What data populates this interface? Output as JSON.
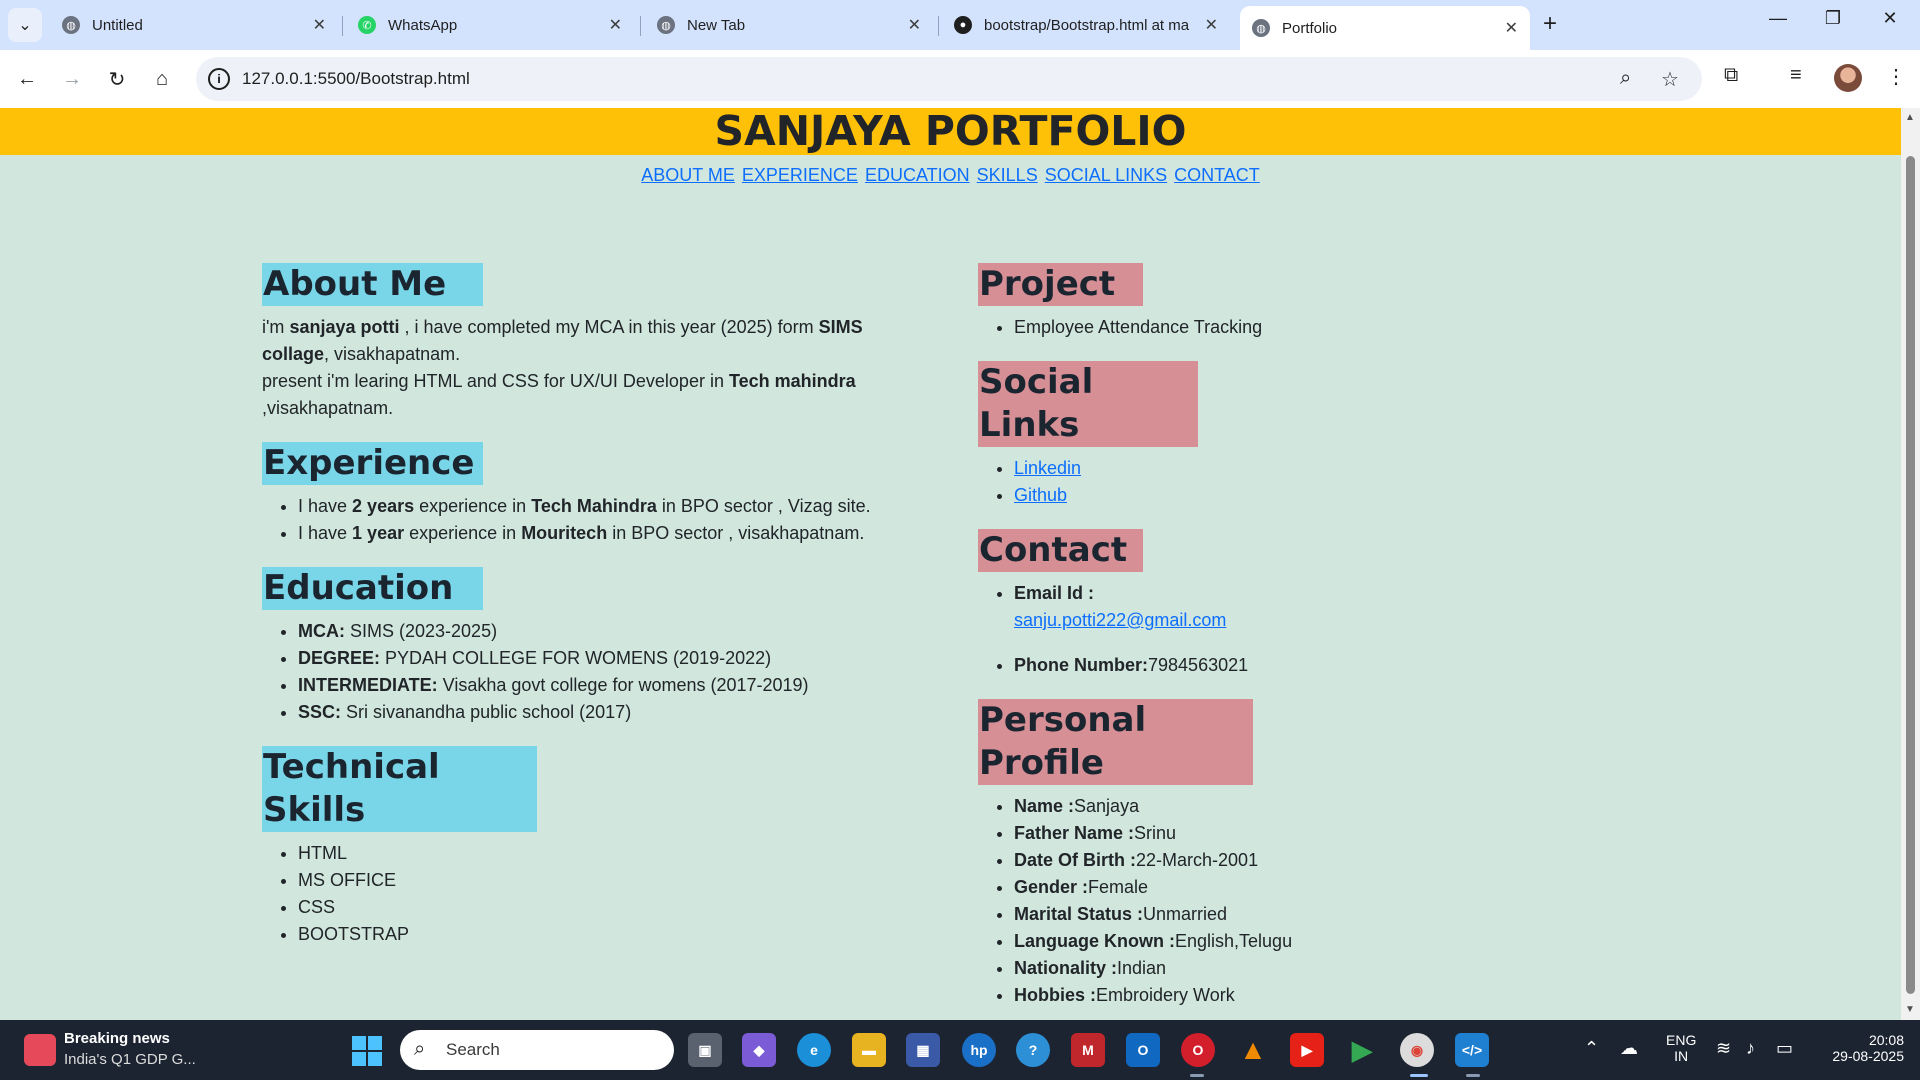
{
  "browser": {
    "tabs": [
      {
        "title": "Untitled",
        "icon": "globe-icon"
      },
      {
        "title": "WhatsApp",
        "icon": "whatsapp-icon"
      },
      {
        "title": "New Tab",
        "icon": "globe-icon"
      },
      {
        "title": "bootstrap/Bootstrap.html at ma",
        "icon": "github-icon"
      },
      {
        "title": "Portfolio",
        "icon": "globe-icon"
      }
    ],
    "url": "127.0.0.1:5500/Bootstrap.html"
  },
  "page": {
    "title": "SANJAYA PORTFOLIO",
    "nav": [
      "ABOUT ME",
      "EXPERIENCE",
      "EDUCATION",
      "SKILLS",
      "SOCIAL LINKS",
      "CONTACT"
    ],
    "about": {
      "heading": "About Me",
      "p1_a": "i'm ",
      "name": "sanjaya potti",
      "p1_b": " , i have completed my MCA in this year (2025) form ",
      "college": "SIMS collage",
      "p1_c": ", visakhapatnam.",
      "p2_a": "present i'm learing HTML and CSS for UX/UI Developer in ",
      "company": "Tech mahindra",
      "p2_b": " ,visakhapatnam."
    },
    "experience": {
      "heading": "Experience",
      "items": [
        {
          "a": "I have ",
          "b1": "2 years",
          "c": " experience in ",
          "b2": "Tech Mahindra",
          "d": " in BPO sector , Vizag site."
        },
        {
          "a": "I have ",
          "b1": "1 year",
          "c": " experience in ",
          "b2": "Mouritech",
          "d": " in BPO sector , visakhapatnam."
        }
      ]
    },
    "education": {
      "heading": "Education",
      "items": [
        {
          "label": "MCA:",
          "value": " SIMS (2023-2025)"
        },
        {
          "label": "DEGREE:",
          "value": " PYDAH COLLEGE FOR WOMENS (2019-2022)"
        },
        {
          "label": "INTERMEDIATE:",
          "value": " Visakha govt college for womens (2017-2019)"
        },
        {
          "label": "SSC:",
          "value": " Sri sivanandha public school (2017)"
        }
      ]
    },
    "skills": {
      "heading": "Technical Skills",
      "items": [
        "HTML",
        "MS OFFICE",
        "CSS",
        "BOOTSTRAP"
      ]
    },
    "project": {
      "heading": "Project",
      "items": [
        "Employee Attendance Tracking"
      ]
    },
    "social": {
      "heading": "Social Links",
      "items": [
        "Linkedin",
        "Github"
      ]
    },
    "contact": {
      "heading": "Contact",
      "email_label": "Email Id :",
      "email": "sanju.potti222@gmail.com",
      "phone_label": "Phone Number:",
      "phone": "7984563021"
    },
    "profile": {
      "heading": "Personal Profile",
      "items": [
        {
          "label": "Name :",
          "value": "Sanjaya"
        },
        {
          "label": "Father Name :",
          "value": "Srinu"
        },
        {
          "label": "Date Of Birth :",
          "value": "22-March-2001"
        },
        {
          "label": "Gender :",
          "value": "Female"
        },
        {
          "label": "Marital Status :",
          "value": "Unmarried"
        },
        {
          "label": "Language Known :",
          "value": "English,Telugu"
        },
        {
          "label": "Nationality :",
          "value": "Indian"
        },
        {
          "label": "Hobbies :",
          "value": "Embroidery Work"
        }
      ]
    }
  },
  "taskbar": {
    "news_title": "Breaking news",
    "news_sub": "India's Q1 GDP G...",
    "search_placeholder": "Search",
    "lang_line1": "ENG",
    "lang_line2": "IN",
    "time": "20:08",
    "date": "29-08-2025"
  },
  "colors": {
    "header": "#ffc107",
    "page_bg": "#d1e7dd",
    "left_heading": "#79d6e8",
    "right_heading": "#d78f96",
    "link": "#0d6efd"
  }
}
